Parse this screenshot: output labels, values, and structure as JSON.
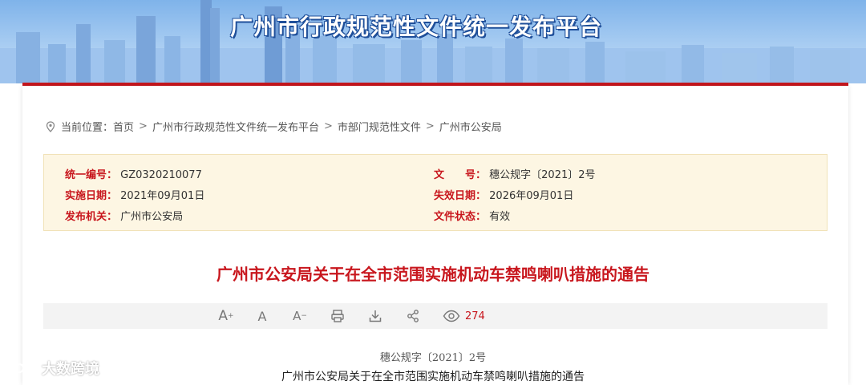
{
  "header": {
    "title": "广州市行政规范性文件统一发布平台"
  },
  "breadcrumb": {
    "prefix": "当前位置：",
    "items": [
      "首页",
      "广州市行政规范性文件统一发布平台",
      "市部门规范性文件",
      "广州市公安局"
    ],
    "separator": ">"
  },
  "meta": {
    "serial_label": "统一编号：",
    "serial_value": "GZ0320210077",
    "docno_label": "文　　号：",
    "docno_value": "穗公规字〔2021〕2号",
    "effective_label": "实施日期：",
    "effective_value": "2021年09月01日",
    "expire_label": "失效日期：",
    "expire_value": "2026年09月01日",
    "issuer_label": "发布机关：",
    "issuer_value": "广州市公安局",
    "status_label": "文件状态：",
    "status_value": "有效"
  },
  "document": {
    "title": "广州市公安局关于在全市范围实施机动车禁鸣喇叭措施的通告",
    "number": "穗公规字〔2021〕2号",
    "subtitle": "广州市公安局关于在全市范围实施机动车禁鸣喇叭措施的通告"
  },
  "toolbar": {
    "font_increase": "A",
    "font_default": "A",
    "font_decrease": "A",
    "view_count": "274"
  },
  "watermark": {
    "text": "大数跨境"
  },
  "colors": {
    "accent_red": "#c8161d",
    "meta_bg": "#fdf6e3",
    "toolbar_bg": "#f3f3f3"
  }
}
